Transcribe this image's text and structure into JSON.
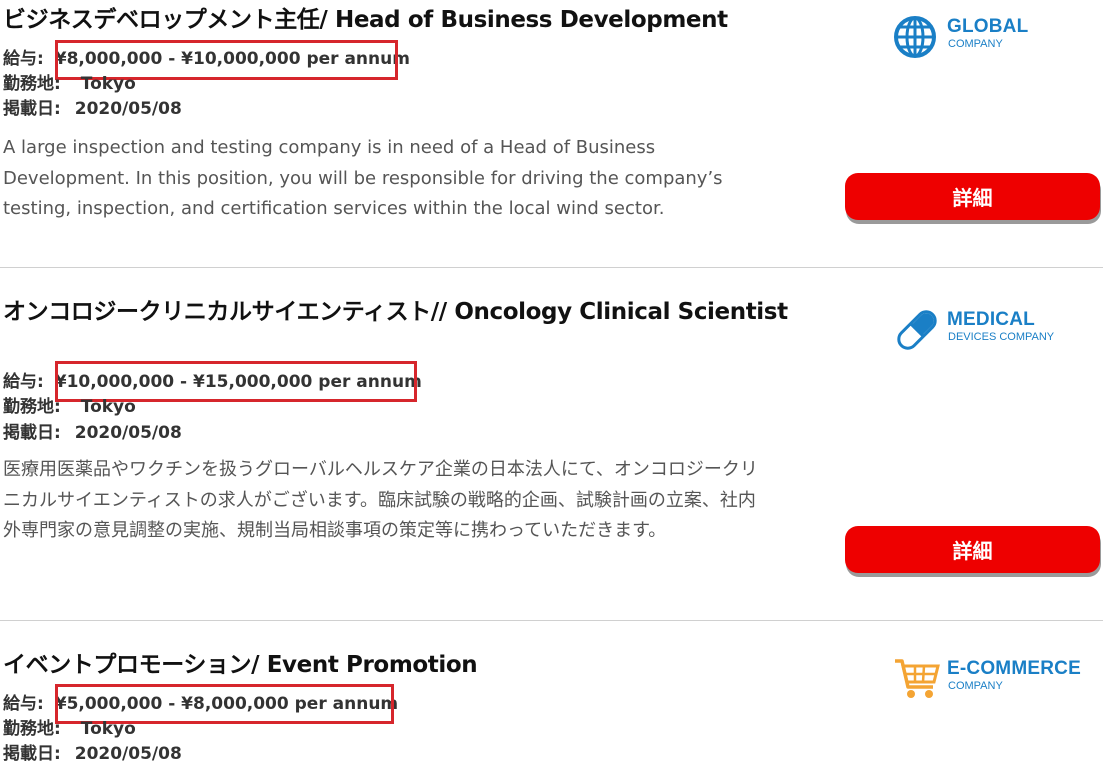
{
  "labels": {
    "salary": "給与:",
    "location": "勤務地:",
    "posted": "掲載日:",
    "detail_button": "詳細"
  },
  "jobs": [
    {
      "title": "ビジネスデベロップメント主任/ Head of Business Development",
      "salary": "¥8,000,000 - ¥10,000,000 per annum",
      "location": "Tokyo",
      "posted": "2020/05/08",
      "description": "A large inspection and testing company is in need of a Head of Business Development. In this position, you will be responsible for driving the company’s testing, inspection, and certification services within the local wind sector.",
      "company": {
        "icon": "globe-icon",
        "title": "GLOBAL",
        "subtitle": "COMPANY"
      }
    },
    {
      "title": "オンコロジークリニカルサイエンティスト// Oncology Clinical Scientist",
      "salary": "¥10,000,000 - ¥15,000,000 per annum",
      "location": "Tokyo",
      "posted": "2020/05/08",
      "description": "医療用医薬品やワクチンを扱うグローバルヘルスケア企業の日本法人にて、オンコロジークリニカルサイエンティストの求人がございます。臨床試験の戦略的企画、試験計画の立案、社内外専門家の意見調整の実施、規制当局相談事項の策定等に携わっていただきます。",
      "company": {
        "icon": "capsule-icon",
        "title": "MEDICAL",
        "subtitle": "DEVICES COMPANY"
      }
    },
    {
      "title": "イベントプロモーション/ Event Promotion",
      "salary": "¥5,000,000 - ¥8,000,000 per annum",
      "location": "Tokyo",
      "posted": "2020/05/08",
      "company": {
        "icon": "shopping-cart-icon",
        "title": "E-COMMERCE",
        "subtitle": "COMPANY"
      }
    }
  ],
  "colors": {
    "highlight_box": "#d6262c",
    "button": "#ee0000",
    "logo_blue": "#1a7fc6",
    "cart_orange": "#f4a433"
  }
}
